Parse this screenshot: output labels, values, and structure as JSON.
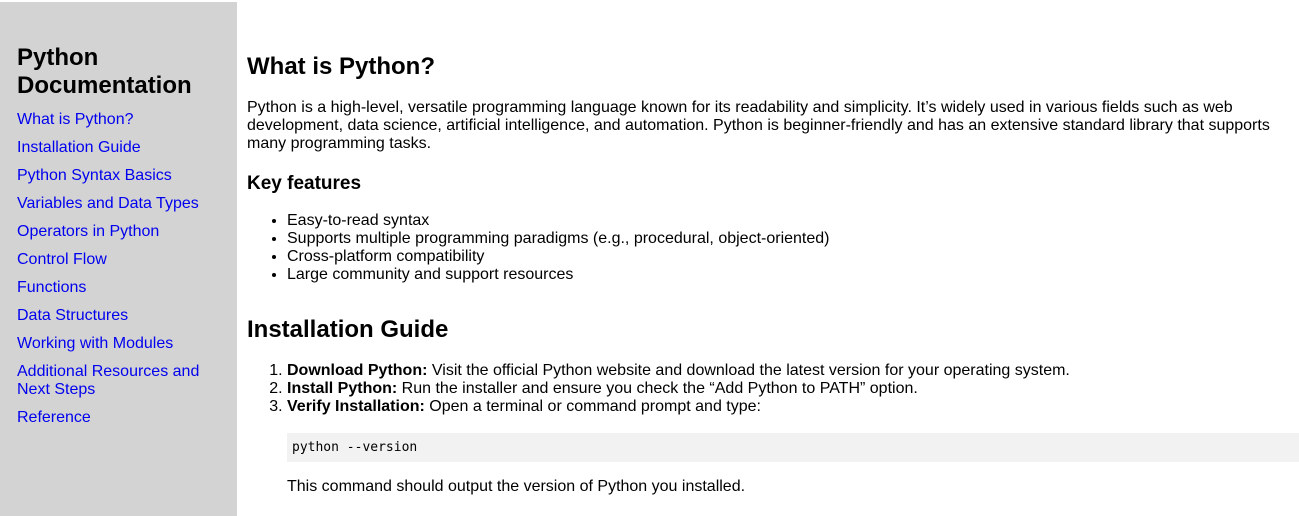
{
  "sidebar": {
    "title": "Python Documentation",
    "items": [
      {
        "label": "What is Python?"
      },
      {
        "label": "Installation Guide"
      },
      {
        "label": "Python Syntax Basics"
      },
      {
        "label": "Variables and Data Types"
      },
      {
        "label": "Operators in Python"
      },
      {
        "label": "Control Flow"
      },
      {
        "label": "Functions"
      },
      {
        "label": "Data Structures"
      },
      {
        "label": "Working with Modules"
      },
      {
        "label": "Additional Resources and Next Steps"
      },
      {
        "label": "Reference"
      }
    ]
  },
  "main": {
    "what_is": {
      "title": "What is Python?",
      "description": "Python is a high-level, versatile programming language known for its readability and simplicity. It’s widely used in various fields such as web development, data science, artificial intelligence, and automation. Python is beginner-friendly and has an extensive standard library that supports many programming tasks.",
      "features_heading": "Key features",
      "features": [
        "Easy-to-read syntax",
        "Supports multiple programming paradigms (e.g., procedural, object-oriented)",
        "Cross-platform compatibility",
        "Large community and support resources"
      ]
    },
    "installation": {
      "title": "Installation Guide",
      "steps": [
        {
          "label": "Download Python:",
          "text": " Visit the official Python website and download the latest version for your operating system."
        },
        {
          "label": "Install Python:",
          "text": " Run the installer and ensure you check the “Add Python to PATH” option."
        },
        {
          "label": "Verify Installation:",
          "text": " Open a terminal or command prompt and type:"
        }
      ],
      "command": "python --version",
      "note": "This command should output the version of Python you installed."
    }
  },
  "colors": {
    "sidebar_bg": "#d3d3d3",
    "link": "#0000ee",
    "code_bg": "#f2f2f2"
  }
}
